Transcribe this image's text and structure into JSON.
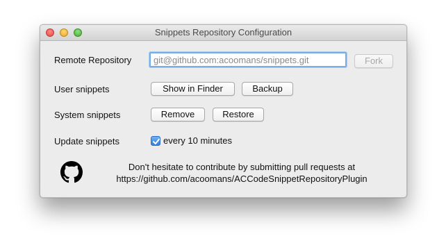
{
  "window": {
    "title": "Snippets Repository Configuration"
  },
  "remote": {
    "label": "Remote Repository",
    "placeholder": "git@github.com:acoomans/snippets.git",
    "fork_label": "Fork"
  },
  "user": {
    "label": "User snippets",
    "show_in_finder_label": "Show in Finder",
    "backup_label": "Backup"
  },
  "system": {
    "label": "System snippets",
    "remove_label": "Remove",
    "restore_label": "Restore"
  },
  "update": {
    "label": "Update snippets",
    "checkbox_label": "every 10 minutes",
    "checked": true
  },
  "footer": {
    "line1": "Don't hesitate to contribute by submitting pull requests at",
    "line2": "https://github.com/acoomans/ACCodeSnippetRepositoryPlugin",
    "icon": "github-icon"
  },
  "colors": {
    "focus_ring": "#78aee6",
    "checkbox_blue": "#2f7fdc",
    "window_bg": "#ececec"
  }
}
